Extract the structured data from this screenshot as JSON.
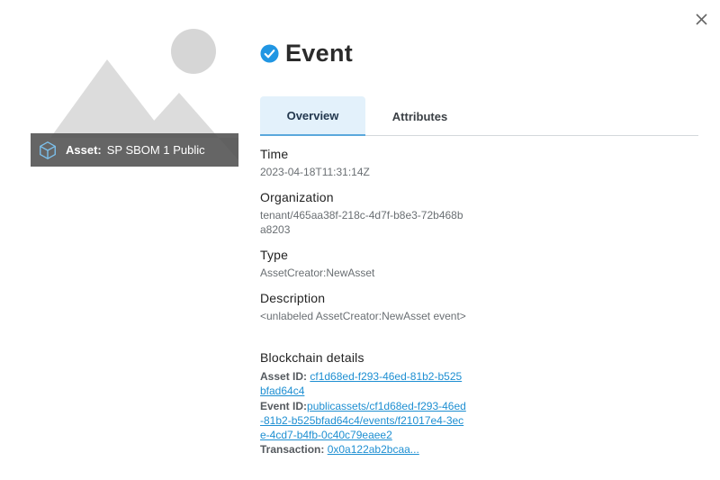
{
  "dialog": {
    "title": "Event"
  },
  "asset": {
    "label": "Asset:",
    "name": "SP SBOM 1 Public"
  },
  "tabs": [
    {
      "label": "Overview",
      "active": true
    },
    {
      "label": "Attributes",
      "active": false
    }
  ],
  "fields": {
    "time": {
      "label": "Time",
      "value": "2023-04-18T11:31:14Z"
    },
    "organization": {
      "label": "Organization",
      "value": "tenant/465aa38f-218c-4d7f-b8e3-72b468ba8203"
    },
    "type": {
      "label": "Type",
      "value": "AssetCreator:NewAsset"
    },
    "description": {
      "label": "Description",
      "value": "<unlabeled AssetCreator:NewAsset event>"
    }
  },
  "blockchain": {
    "label": "Blockchain details",
    "asset_id_label": "Asset ID:",
    "asset_id": "cf1d68ed-f293-46ed-81b2-b525bfad64c4",
    "event_id_label": "Event ID:",
    "event_id": "publicassets/cf1d68ed-f293-46ed-81b2-b525bfad64c4/events/f21017e4-3ece-4cd7-b4fb-0c40c79eaee2",
    "transaction_label": "Transaction:",
    "transaction": "0x0a122ab2bcaa..."
  },
  "colors": {
    "accent": "#1e8fd2",
    "verified": "#2196e3",
    "tab_active_bg": "#e3f1fb",
    "asset_bar_bg": "#505050"
  },
  "icons": {
    "close": "close-icon",
    "cube": "cube-icon",
    "verified": "verified-check-icon",
    "placeholder": "image-placeholder-icon"
  }
}
